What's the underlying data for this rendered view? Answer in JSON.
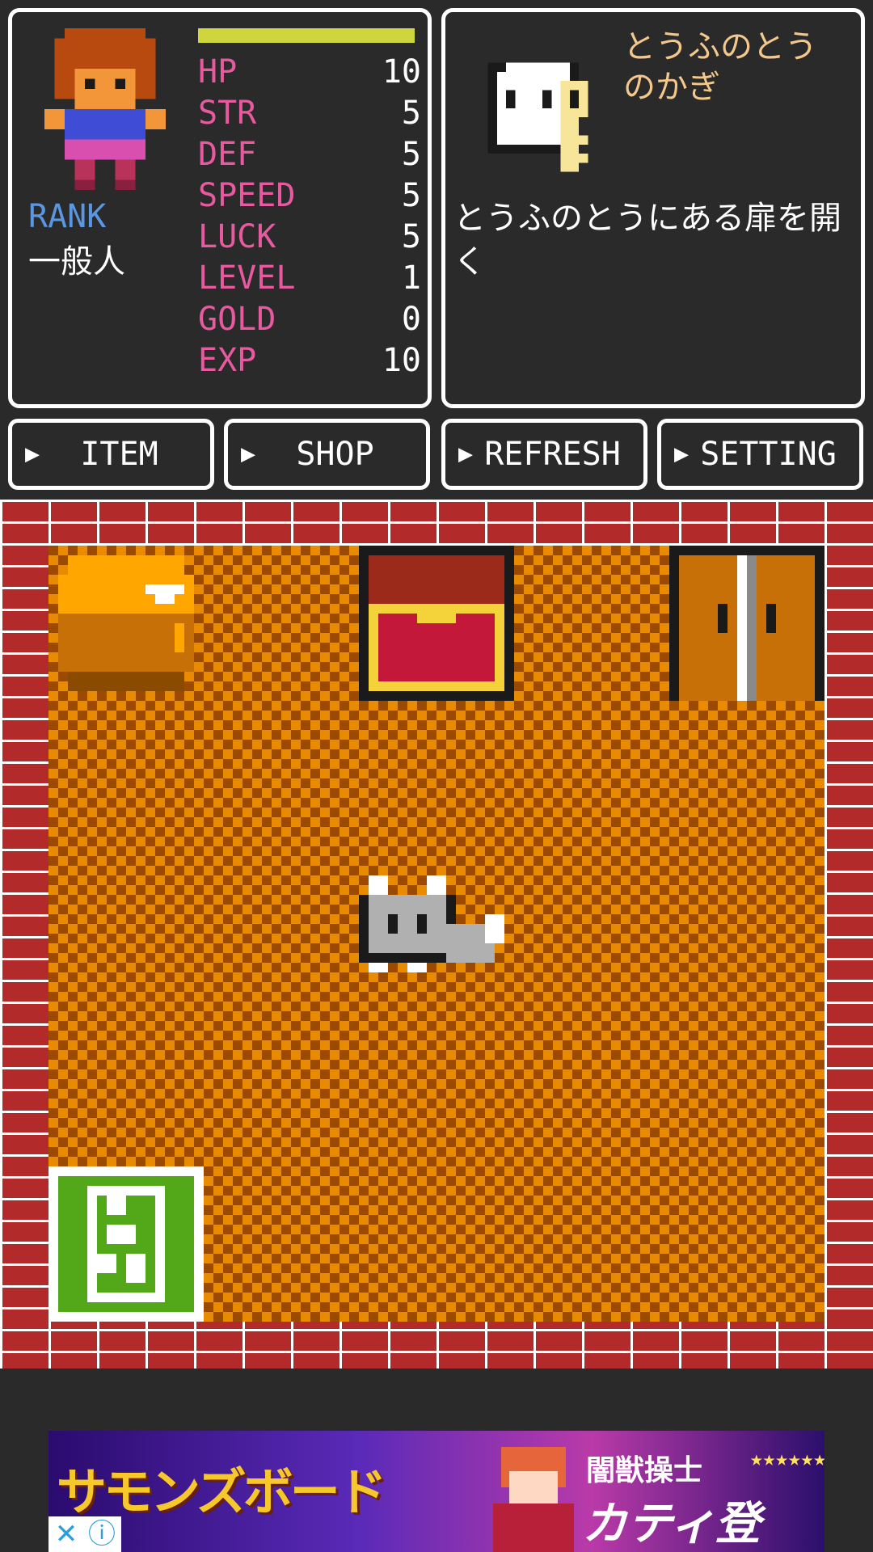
{
  "status": {
    "stats": [
      {
        "label": "HP",
        "value": "10"
      },
      {
        "label": "STR",
        "value": "5"
      },
      {
        "label": "DEF",
        "value": "5"
      },
      {
        "label": "SPEED",
        "value": "5"
      },
      {
        "label": "LUCK",
        "value": "5"
      },
      {
        "label": "LEVEL",
        "value": "1"
      },
      {
        "label": "GOLD",
        "value": "0"
      },
      {
        "label": "EXP",
        "value": "10"
      }
    ],
    "rank_label": "RANK",
    "rank_value": "一般人",
    "hp_fill": 1.0
  },
  "item": {
    "name": "とうふのとうのかぎ",
    "description": "とうふのとうにある扉を開く"
  },
  "menu": {
    "item": "ITEM",
    "shop": "SHOP",
    "refresh": "REFRESH",
    "setting": "SETTING",
    "arrow": "▶"
  },
  "field": {
    "tiles": [
      "pot",
      "treasure-chest",
      "door",
      "cat",
      "exit-sign"
    ]
  },
  "ad": {
    "logo": "サモンズボード",
    "title1": "闇獣操士",
    "stars": "★★★★★★★",
    "title2": "カティ登場!!",
    "close": "✕",
    "info": "ⓘ"
  },
  "colors": {
    "stat_label": "#e85aa0",
    "rank_label": "#5b97e0",
    "item_name": "#f4c88b",
    "hp_bar": "#cfd53d",
    "brick": "#b22a2a",
    "floor_dark": "#9c4a00",
    "floor_light": "#e88b00"
  }
}
